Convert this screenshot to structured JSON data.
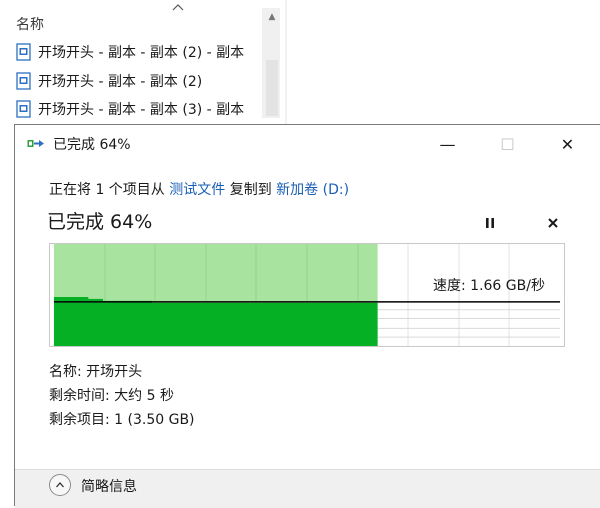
{
  "explorer": {
    "column_header": "名称",
    "files": [
      {
        "name": "开场开头 - 副本 - 副本 (2) - 副本"
      },
      {
        "name": "开场开头 - 副本 - 副本 (2)"
      },
      {
        "name": "开场开头 - 副本 - 副本 (3) - 副本"
      }
    ]
  },
  "dialog": {
    "title": "已完成 64%",
    "window_buttons": {
      "minimize": "—",
      "maximize": "☐",
      "close": "✕"
    },
    "copy_line": {
      "prefix": "正在将 1 个项目从 ",
      "source": "测试文件",
      "middle": " 复制到 ",
      "destination": "新加卷 (D:)"
    },
    "status": "已完成 64%",
    "progress": 0.64,
    "speed": "速度: 1.66 GB/秒",
    "details": {
      "name_line": "名称: 开场开头",
      "time_left_line": "剩余时间: 大约 5 秒",
      "items_left_line": "剩余项目: 1 (3.50 GB)"
    },
    "footer": {
      "toggle_label": "简略信息"
    },
    "colors": {
      "progress_light": "#a8e4a0",
      "progress_dark": "#06b025",
      "link": "#1a5fb4"
    }
  }
}
